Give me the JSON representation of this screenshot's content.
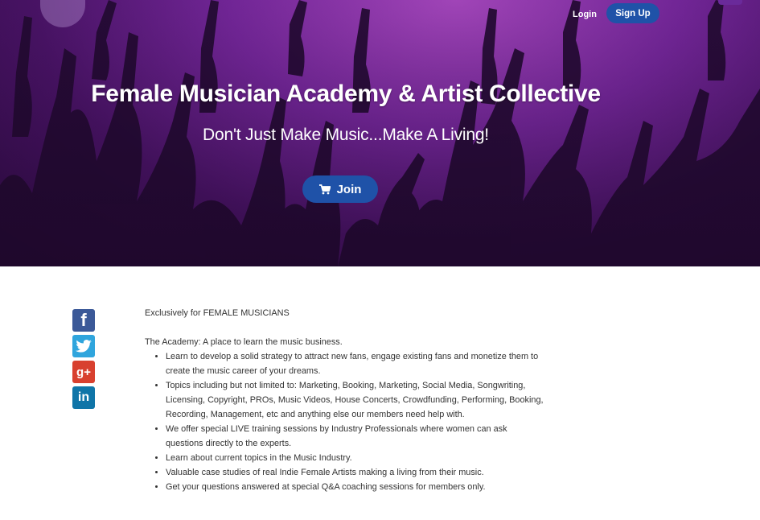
{
  "header": {
    "login_label": "Login",
    "signup_label": "Sign Up"
  },
  "hero": {
    "title": "Female Musician Academy & Artist Collective",
    "subtitle": "Don't Just Make Music...Make A Living!",
    "join_label": "Join",
    "join_icon": "shopping-cart-icon"
  },
  "social": {
    "items": [
      {
        "name": "facebook",
        "icon": "facebook-icon",
        "color": "#3b5998"
      },
      {
        "name": "twitter",
        "icon": "twitter-icon",
        "color": "#2fa5dd"
      },
      {
        "name": "google-plus",
        "icon": "google-plus-icon",
        "color": "#d8402f"
      },
      {
        "name": "linkedin",
        "icon": "linkedin-icon",
        "color": "#0f75a8"
      }
    ]
  },
  "content": {
    "intro": "Exclusively for FEMALE MUSICIANS",
    "academy_heading": "The Academy: A place to learn the music business.",
    "bullets": [
      "Learn to develop a solid strategy to attract new fans, engage existing fans and monetize them to create the music career of your dreams.",
      "Topics including but not limited to: Marketing, Booking, Marketing, Social Media, Songwriting, Licensing, Copyright, PROs, Music Videos, House Concerts, Crowdfunding, Performing, Booking, Recording, Management, etc and anything else our members need help with.",
      "We offer special LIVE training sessions by Industry Professionals where women can ask questions directly to the experts.",
      "Learn about current topics in the Music Industry.",
      "Valuable case studies of real Indie Female Artists making a living from their music.",
      "Get your questions answered at special Q&A coaching sessions for members only."
    ]
  },
  "colors": {
    "primary_button": "#1f52a8",
    "hero_purple": "#7a2aa0"
  }
}
